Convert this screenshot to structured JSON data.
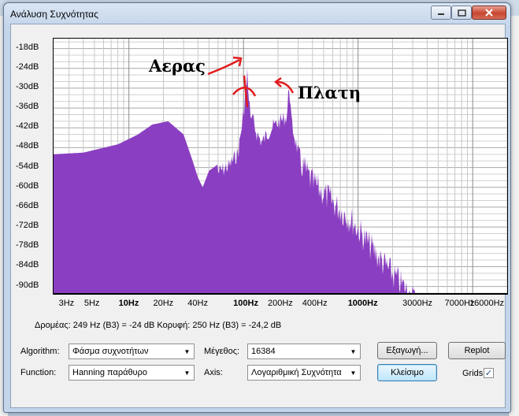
{
  "window": {
    "title": "Ανάλυση Συχνότητας"
  },
  "yaxis": {
    "ticks": [
      "-18dB",
      "-24dB",
      "-30dB",
      "-36dB",
      "-42dB",
      "-48dB",
      "-54dB",
      "-60dB",
      "-66dB",
      "-72dB",
      "-78dB",
      "-84dB",
      "-90dB"
    ]
  },
  "xaxis": {
    "ticks": [
      "3Hz",
      "5Hz",
      "10Hz",
      "20Hz",
      "40Hz",
      "100Hz",
      "200Hz",
      "400Hz",
      "1000Hz",
      "3000Hz",
      "7000Hz",
      "16000Hz"
    ]
  },
  "annotations": {
    "left": "Αερας",
    "right": "Πλατη"
  },
  "status": {
    "text": "Δρομέας: 249 Hz (B3) = -24 dB     Κορυφή: 250 Hz (B3) = -24,2 dB"
  },
  "controls": {
    "algorithm_label": "Algorithm:",
    "algorithm_value": "Φάσμα συχνοτήτων",
    "size_label": "Μέγεθος:",
    "size_value": "16384",
    "export_label": "Εξαγωγή...",
    "replot_label": "Replot",
    "function_label": "Function:",
    "function_value": "Hanning παράθυρο",
    "axis_label": "Axis:",
    "axis_value": "Λογαριθμική Συχνότητα",
    "close_label": "Κλείσιμο",
    "grids_label": "Grids",
    "grids_checked": "✓"
  },
  "colors": {
    "spectrum": "#8a3ec1",
    "grid": "#b0b0b0",
    "annotation": "#e11c1c"
  }
}
